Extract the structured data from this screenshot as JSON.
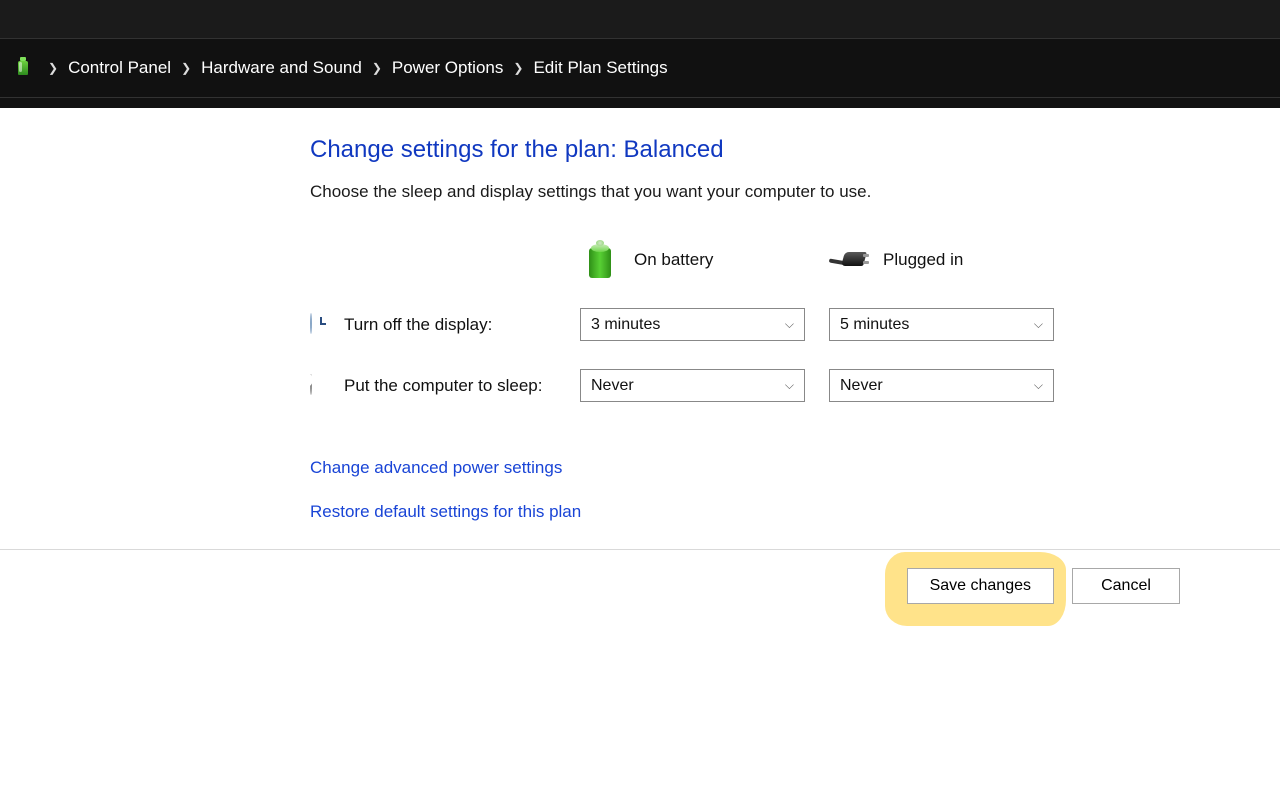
{
  "breadcrumb": {
    "items": [
      "Control Panel",
      "Hardware and Sound",
      "Power Options",
      "Edit Plan Settings"
    ]
  },
  "page": {
    "title": "Change settings for the plan: Balanced",
    "description": "Choose the sleep and display settings that you want your computer to use."
  },
  "columns": {
    "battery": "On battery",
    "plugged": "Plugged in"
  },
  "rows": {
    "display": {
      "label": "Turn off the display:",
      "battery_value": "3 minutes",
      "plugged_value": "5 minutes"
    },
    "sleep": {
      "label": "Put the computer to sleep:",
      "battery_value": "Never",
      "plugged_value": "Never"
    }
  },
  "links": {
    "advanced": "Change advanced power settings",
    "restore": "Restore default settings for this plan"
  },
  "buttons": {
    "save": "Save changes",
    "cancel": "Cancel"
  }
}
